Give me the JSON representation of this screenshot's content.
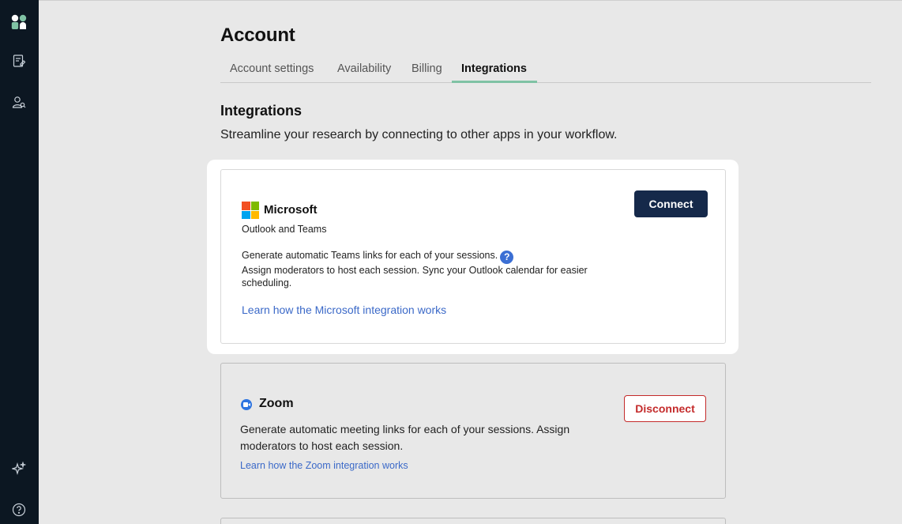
{
  "page": {
    "title": "Account",
    "tabs": [
      {
        "label": "Account settings"
      },
      {
        "label": "Availability"
      },
      {
        "label": "Billing"
      },
      {
        "label": "Integrations",
        "active": true
      }
    ]
  },
  "section": {
    "title": "Integrations",
    "subtitle": "Streamline your research by connecting to other apps in your workflow."
  },
  "microsoft": {
    "name": "Microsoft",
    "subtitle": "Outlook and Teams",
    "desc_line1": "Generate automatic Teams links for each of your sessions.",
    "desc_rest": "Assign moderators to host each session. Sync your Outlook calendar for easier scheduling.",
    "help_glyph": "?",
    "link": "Learn how the Microsoft integration works",
    "button": "Connect",
    "logo_colors": [
      "#f25022",
      "#7fba00",
      "#00a4ef",
      "#ffb900"
    ]
  },
  "zoom": {
    "name": "Zoom",
    "desc": "Generate automatic meeting links for each of your sessions. Assign moderators to host each session.",
    "link": "Learn how the Zoom integration works",
    "button": "Disconnect"
  },
  "sidebar": {
    "icons": [
      "logo-icon",
      "notes-icon",
      "user-search-icon",
      "sparkle-icon",
      "help-circle-icon"
    ]
  },
  "colors": {
    "sidebar_bg": "#0c1722",
    "primary_button": "#15294a",
    "danger": "#c42b2b",
    "link": "#3b69c8",
    "active_tab": "#7fc2a4"
  }
}
